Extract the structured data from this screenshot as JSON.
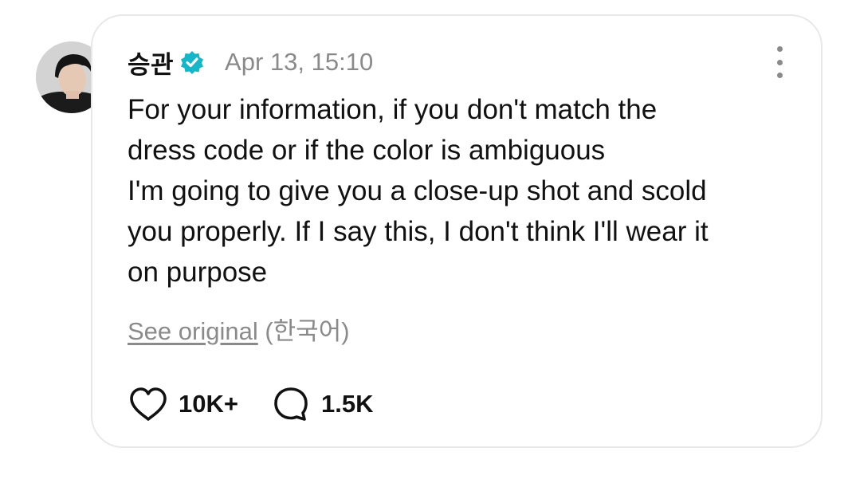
{
  "post": {
    "author": {
      "name": "승관",
      "verified": true,
      "verified_color": "#16b6c9",
      "avatar_icon": "profile-photo"
    },
    "timestamp": "Apr 13, 15:10",
    "menu_icon": "more-vertical-icon",
    "text": "For your information, if you don't match the\ndress code or if the color is ambiguous\nI'm going to give you a close-up shot and scold\nyou properly. If I say this, I don't think I'll wear it\non purpose",
    "translation": {
      "link_label": "See original",
      "language": "(한국어)"
    },
    "actions": {
      "likes": {
        "icon": "heart-icon",
        "count": "10K+"
      },
      "comments": {
        "icon": "comment-bubble-icon",
        "count": "1.5K"
      }
    }
  },
  "colors": {
    "text_primary": "#111111",
    "text_secondary": "#8a8a8a",
    "card_border": "#e8e8e8"
  }
}
